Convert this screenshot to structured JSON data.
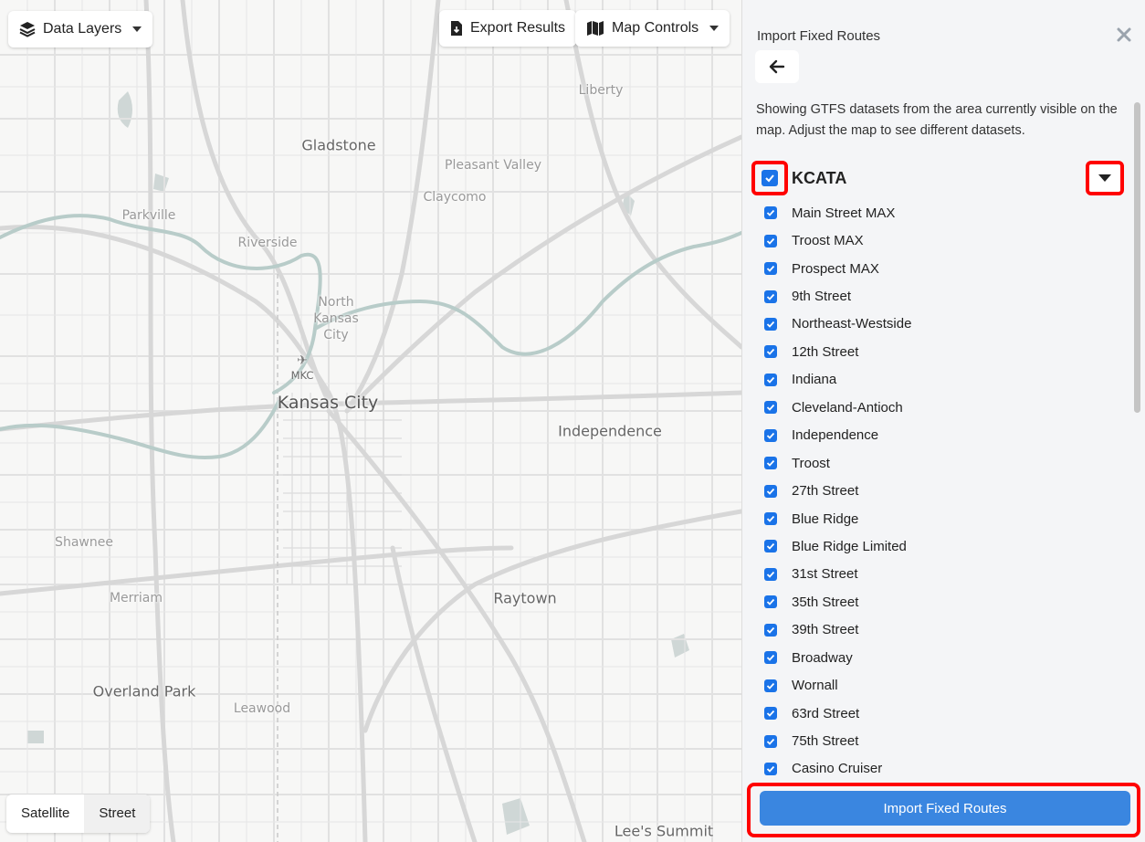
{
  "map": {
    "places": [
      {
        "id": "liberty",
        "name": "Liberty"
      },
      {
        "id": "gladstone",
        "name": "Gladstone"
      },
      {
        "id": "pleasant-valley",
        "name": "Pleasant Valley"
      },
      {
        "id": "claycomo",
        "name": "Claycomo"
      },
      {
        "id": "parkville",
        "name": "Parkville"
      },
      {
        "id": "riverside",
        "name": "Riverside"
      },
      {
        "id": "north-kansas-city",
        "name": "North Kansas City"
      },
      {
        "id": "mkc",
        "name": "MKC"
      },
      {
        "id": "kansas-city",
        "name": "Kansas City"
      },
      {
        "id": "independence",
        "name": "Independence"
      },
      {
        "id": "shawnee",
        "name": "Shawnee"
      },
      {
        "id": "merriam",
        "name": "Merriam"
      },
      {
        "id": "raytown",
        "name": "Raytown"
      },
      {
        "id": "overland-park",
        "name": "Overland Park"
      },
      {
        "id": "leawood",
        "name": "Leawood"
      },
      {
        "id": "lees-summit",
        "name": "Lee's Summit"
      }
    ],
    "controls": {
      "data_layers": "Data Layers",
      "export_results": "Export Results",
      "map_controls": "Map Controls"
    },
    "basemap": {
      "satellite": "Satellite",
      "street": "Street",
      "active": "street"
    }
  },
  "panel": {
    "title": "Import Fixed Routes",
    "intro": "Showing GTFS datasets from the area currently visible on the map. Adjust the map to see different datasets.",
    "agency": {
      "name": "KCATA",
      "checked": true
    },
    "routes": [
      "Main Street MAX",
      "Troost MAX",
      "Prospect MAX",
      "9th Street",
      "Northeast-Westside",
      "12th Street",
      "Indiana",
      "Cleveland-Antioch",
      "Independence",
      "Troost",
      "27th Street",
      "Blue Ridge",
      "Blue Ridge Limited",
      "31st Street",
      "35th Street",
      "39th Street",
      "Broadway",
      "Wornall",
      "63rd Street",
      "75th Street",
      "Casino Cruiser"
    ],
    "import_button": "Import Fixed Routes"
  },
  "colors": {
    "accent": "#3a86e0",
    "checkbox": "#1a73e8",
    "highlight": "#ff0000",
    "water": "#b8ccc9"
  }
}
